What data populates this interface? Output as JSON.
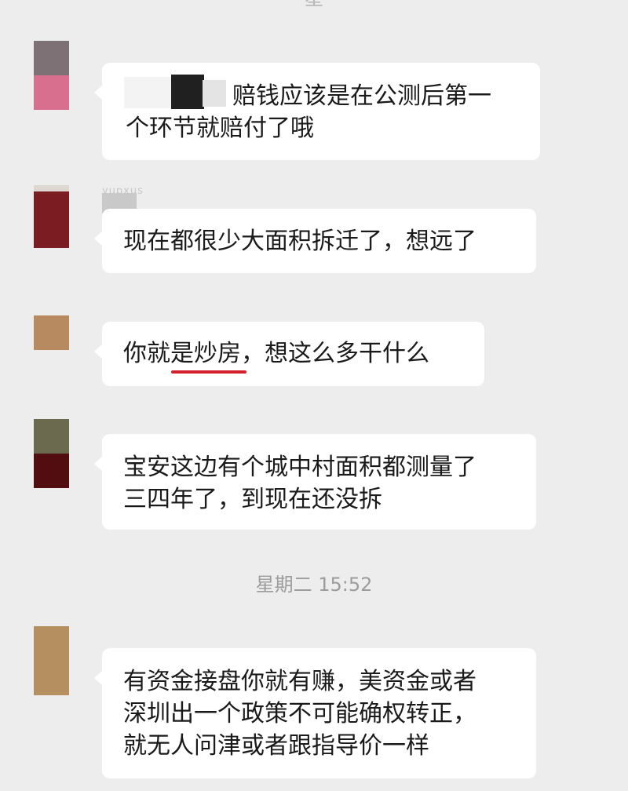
{
  "top_time_partial": "星",
  "sender_name_partial": "yupxus",
  "messages": [
    {
      "lines": [
        "赔钱应该是在公测后第一",
        "个环节就赔付了哦"
      ]
    },
    {
      "lines": [
        "现在都很少大面积拆迁了，想远了"
      ]
    },
    {
      "lines": [
        "你就是炒房，想这么多干什么"
      ]
    },
    {
      "lines": [
        "宝安这边有个城中村面积都测量了",
        "三四年了，到现在还没拆"
      ]
    },
    {
      "lines": [
        "有资金接盘你就有赚，美资金或者",
        "深圳出一个政策不可能确权转正，",
        "就无人问津或者跟指导价一样"
      ]
    }
  ],
  "timestamp": "星期二 15:52",
  "colors": {
    "background": "#ededed",
    "bubble": "#ffffff",
    "underline": "#d3202b"
  }
}
